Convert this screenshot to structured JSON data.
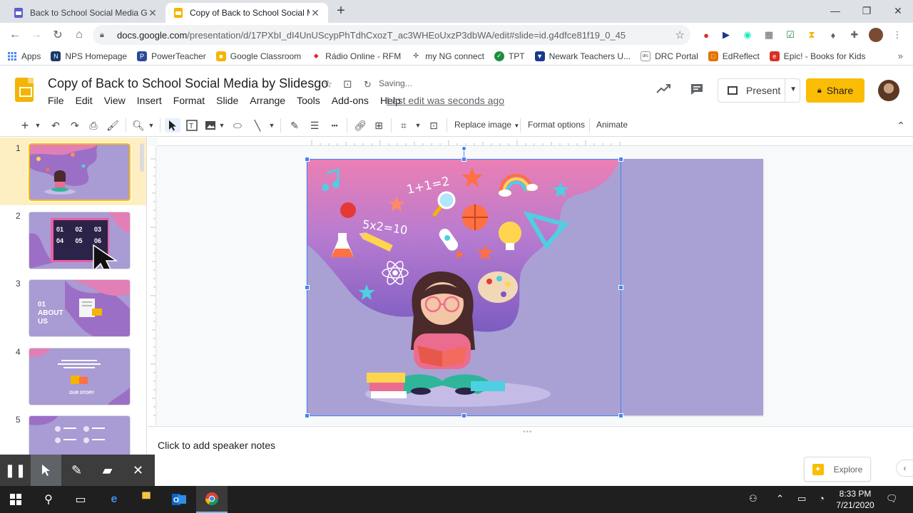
{
  "browser": {
    "tabs": [
      {
        "title": "Back to School Social Media Goo",
        "active": false
      },
      {
        "title": "Copy of Back to School Social Me",
        "active": true
      }
    ],
    "new_tab": "+",
    "url_prefix": "docs.google.com",
    "url_path": "/presentation/d/17PXbI_dI4UnUScypPhTdhCxozT_ac3WHEoUxzP3dbWA/edit#slide=id.g4dfce81f19_0_45",
    "bookmarks": [
      {
        "label": "Apps",
        "color": "#4285f4"
      },
      {
        "label": "NPS Homepage",
        "color": "#1a3a6b"
      },
      {
        "label": "PowerTeacher",
        "color": "#2c4a9a"
      },
      {
        "label": "Google Classroom",
        "color": "#f4b400"
      },
      {
        "label": "Rádio Online - RFM",
        "color": "#d93025"
      },
      {
        "label": "my NG connect",
        "color": "#3c4043"
      },
      {
        "label": "TPT",
        "color": "#1e8e3e"
      },
      {
        "label": "Newark Teachers U...",
        "color": "#1a3a8a"
      },
      {
        "label": "DRC Portal",
        "color": "#5f6368"
      },
      {
        "label": "EdReflect",
        "color": "#e37400"
      },
      {
        "label": "Epic! - Books for Kids",
        "color": "#d93025"
      }
    ],
    "bookmarks_more": "»"
  },
  "app": {
    "doc_title": "Copy of Back to School Social Media by Slidesgo",
    "saving_status": "Saving...",
    "menu": [
      "File",
      "Edit",
      "View",
      "Insert",
      "Format",
      "Slide",
      "Arrange",
      "Tools",
      "Add-ons",
      "Help"
    ],
    "last_edit": "Last edit was seconds ago",
    "present_label": "Present",
    "share_label": "Share",
    "accent_color": "#fbbc04"
  },
  "toolbar": {
    "replace_image": "Replace image",
    "format_options": "Format options",
    "animate": "Animate"
  },
  "filmstrip": {
    "slides": [
      {
        "number": "1",
        "selected": true,
        "label": ""
      },
      {
        "number": "2",
        "selected": false,
        "label": "01  02  03  04  05  06"
      },
      {
        "number": "3",
        "selected": false,
        "label": "01 ABOUT US"
      },
      {
        "number": "4",
        "selected": false,
        "label": "OUR STORY"
      },
      {
        "number": "5",
        "selected": false,
        "label": ""
      }
    ]
  },
  "slide": {
    "math_text_1": "1+1=2",
    "math_text_2": "5x2=10",
    "background_color": "#a9a1d4"
  },
  "notes": {
    "placeholder": "Click to add speaker notes"
  },
  "explore": {
    "label": "Explore"
  },
  "taskbar": {
    "time": "8:33 PM",
    "date": "7/21/2020"
  }
}
